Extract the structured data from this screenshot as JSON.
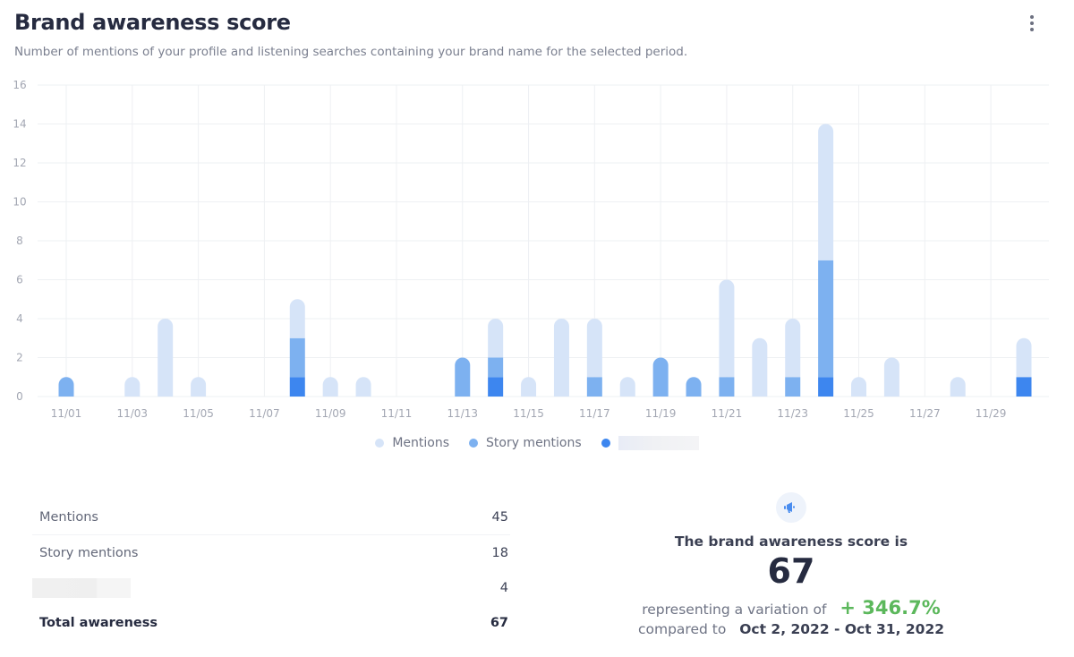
{
  "header": {
    "title": "Brand awareness score",
    "subtitle": "Number of mentions of your profile and listening searches containing your brand name for the selected period.",
    "menu_icon": "kebab-menu-icon"
  },
  "colors": {
    "mentions": "#d6e4f8",
    "story_mentions": "#7db1f0",
    "hidden_series": "#3d86ef",
    "grid": "#eef0f3",
    "axis_text": "#a3a7b3",
    "positive": "#5cb85c"
  },
  "chart_data": {
    "type": "bar",
    "stacked": true,
    "title": "Brand awareness score",
    "xlabel": "",
    "ylabel": "",
    "ylim": [
      0,
      16
    ],
    "yticks": [
      0,
      2,
      4,
      6,
      8,
      10,
      12,
      14,
      16
    ],
    "grid": true,
    "legend_position": "bottom-center",
    "categories": [
      "11/01",
      "11/02",
      "11/03",
      "11/04",
      "11/05",
      "11/06",
      "11/07",
      "11/08",
      "11/09",
      "11/10",
      "11/11",
      "11/12",
      "11/13",
      "11/14",
      "11/15",
      "11/16",
      "11/17",
      "11/18",
      "11/19",
      "11/20",
      "11/21",
      "11/22",
      "11/23",
      "11/24",
      "11/25",
      "11/26",
      "11/27",
      "11/28",
      "11/29",
      "11/30"
    ],
    "xtick_labels": [
      "11/01",
      "11/03",
      "11/05",
      "11/07",
      "11/09",
      "11/11",
      "11/13",
      "11/15",
      "11/17",
      "11/19",
      "11/21",
      "11/23",
      "11/25",
      "11/27",
      "11/29"
    ],
    "series": [
      {
        "name": "[redacted]",
        "key": "hidden_series",
        "values": [
          0,
          0,
          0,
          0,
          0,
          0,
          0,
          1,
          0,
          0,
          0,
          0,
          0,
          1,
          0,
          0,
          0,
          0,
          0,
          0,
          0,
          0,
          0,
          1,
          0,
          0,
          0,
          0,
          0,
          1
        ]
      },
      {
        "name": "Story mentions",
        "key": "story_mentions",
        "values": [
          1,
          0,
          0,
          0,
          0,
          0,
          0,
          2,
          0,
          0,
          0,
          0,
          2,
          1,
          0,
          0,
          1,
          0,
          2,
          1,
          1,
          0,
          1,
          6,
          0,
          0,
          0,
          0,
          0,
          0
        ]
      },
      {
        "name": "Mentions",
        "key": "mentions",
        "values": [
          0,
          0,
          1,
          4,
          1,
          0,
          0,
          2,
          1,
          1,
          0,
          0,
          0,
          2,
          1,
          4,
          3,
          1,
          0,
          0,
          5,
          3,
          3,
          7,
          1,
          2,
          0,
          1,
          0,
          2
        ]
      }
    ]
  },
  "legend": [
    {
      "label": "Mentions",
      "key": "mentions"
    },
    {
      "label": "Story mentions",
      "key": "story_mentions"
    },
    {
      "label": "",
      "key": "hidden_series",
      "redacted": true
    }
  ],
  "summary_table": {
    "rows": [
      {
        "label": "Mentions",
        "value": "45"
      },
      {
        "label": "Story mentions",
        "value": "18"
      },
      {
        "label": "",
        "value": "4",
        "redacted": true
      }
    ],
    "total": {
      "label": "Total awareness",
      "value": "67"
    }
  },
  "score_panel": {
    "icon": "megaphone-icon",
    "heading": "The brand awareness score is",
    "value": "67",
    "variation_prefix": "representing a variation of",
    "variation_value": "+ 346.7%",
    "compare_prefix": "compared to",
    "compare_range": "Oct 2, 2022 - Oct 31, 2022"
  }
}
